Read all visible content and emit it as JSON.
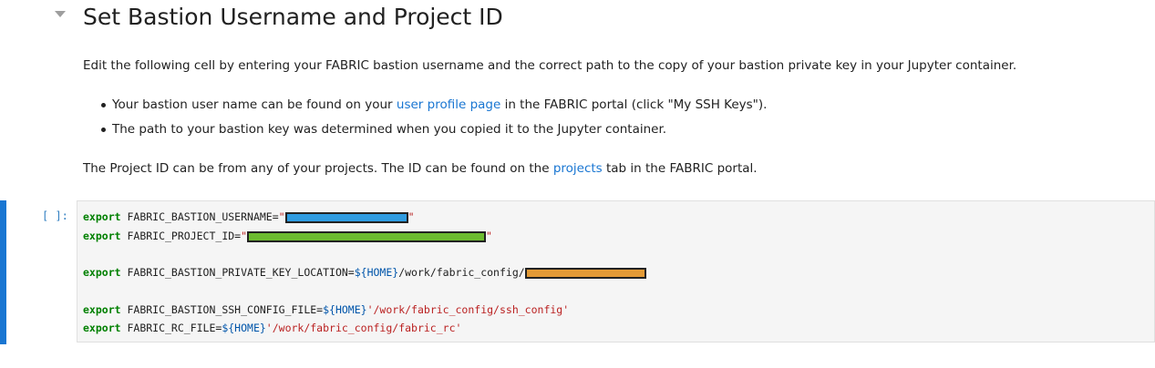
{
  "markdown": {
    "heading": "Set Bastion Username and Project ID",
    "intro": "Edit the following cell by entering your FABRIC bastion username and the correct path to the copy of your bastion private key in your Jupyter container.",
    "bullets": [
      {
        "pre": "Your bastion user name can be found on your ",
        "link": "user profile page",
        "post": " in the FABRIC portal (click \"My SSH Keys\")."
      },
      {
        "text": "The path to your bastion key was determined when you copied it to the Jupyter container."
      }
    ],
    "project_note": {
      "pre": "The Project ID can be from any of your projects. The ID can be found on the ",
      "link": "projects",
      "post": " tab in the FABRIC portal."
    }
  },
  "cell": {
    "prompt": "[ ]:",
    "lines": [
      {
        "keyword": "export",
        "name": " FABRIC_BASTION_USERNAME=",
        "open": "\"",
        "redact_color": "#2e9be0",
        "close": "\""
      },
      {
        "keyword": "export",
        "name": " FABRIC_PROJECT_ID=",
        "open": "\"",
        "redact_color": "#6cbb2f",
        "close": "\""
      },
      {
        "keyword": "export",
        "name": " FABRIC_BASTION_PRIVATE_KEY_LOCATION=",
        "var": "${HOME}",
        "rest": "/work/fabric_config/",
        "redact_color": "#e39a36"
      },
      {
        "keyword": "export",
        "name": " FABRIC_BASTION_SSH_CONFIG_FILE=",
        "var": "${HOME}",
        "str": "'/work/fabric_config/ssh_config'"
      },
      {
        "keyword": "export",
        "name": " FABRIC_RC_FILE=",
        "var": "${HOME}",
        "str": "'/work/fabric_config/fabric_rc'"
      }
    ]
  },
  "colors": {
    "accent": "#1976d2",
    "keyword": "#008000",
    "string": "#ba2121"
  }
}
